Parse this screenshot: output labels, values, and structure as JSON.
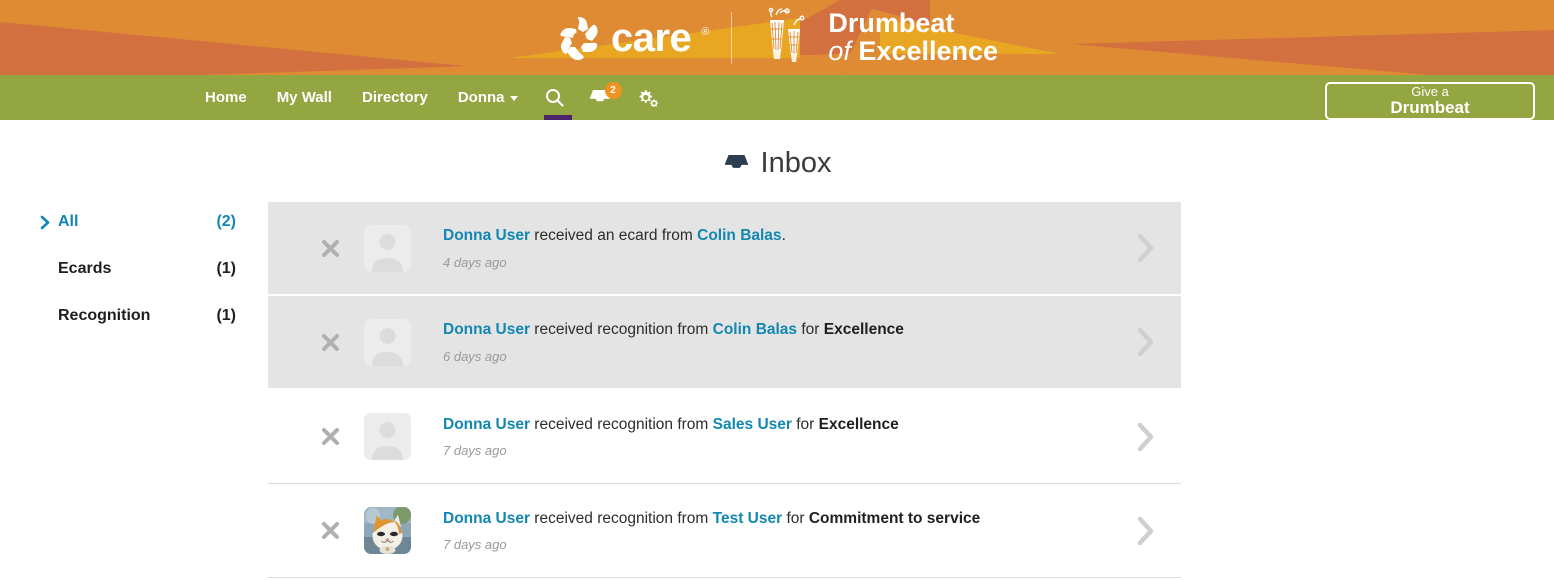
{
  "brand": {
    "logo_name": "care",
    "logo_registered": "®",
    "title_line1": "Drumbeat",
    "title_line2_italic": "of",
    "title_line2_bold": "Excellence",
    "header_bg": "#d2713f",
    "header_accent": "#df8b33",
    "header_highlight": "#e8a622"
  },
  "nav": {
    "bg": "#93a642",
    "items": [
      {
        "label": "Home",
        "has_caret": false
      },
      {
        "label": "My Wall",
        "has_caret": false
      },
      {
        "label": "Directory",
        "has_caret": false
      },
      {
        "label": "Donna",
        "has_caret": true
      }
    ],
    "icons": [
      {
        "name": "search-icon"
      },
      {
        "name": "inbox-icon",
        "badge": "2"
      },
      {
        "name": "settings-gears-icon"
      }
    ],
    "badge_color": "#f0921f",
    "active_indicator_color": "#4b2569",
    "give_button": {
      "line1": "Give a",
      "line2": "Drumbeat"
    }
  },
  "page": {
    "title": "Inbox",
    "title_icon": "inbox-icon"
  },
  "sidebar": {
    "items": [
      {
        "label": "All",
        "count": "(2)",
        "active": true
      },
      {
        "label": "Ecards",
        "count": "(1)",
        "active": false
      },
      {
        "label": "Recognition",
        "count": "(1)",
        "active": false
      }
    ]
  },
  "messages": [
    {
      "recipient": "Donna User",
      "middle": " received an ecard from ",
      "sender": "Colin Balas",
      "suffix": ".",
      "for_label": "",
      "award": "",
      "time": "4 days ago",
      "unread": true,
      "avatar": "placeholder-silhouette"
    },
    {
      "recipient": "Donna User",
      "middle": " received recognition from ",
      "sender": "Colin Balas",
      "suffix": "",
      "for_label": " for ",
      "award": "Excellence",
      "time": "6 days ago",
      "unread": true,
      "avatar": "placeholder-silhouette"
    },
    {
      "recipient": "Donna User",
      "middle": " received recognition from ",
      "sender": "Sales User",
      "suffix": "",
      "for_label": " for ",
      "award": "Excellence",
      "time": "7 days ago",
      "unread": false,
      "avatar": "placeholder-silhouette"
    },
    {
      "recipient": "Donna User",
      "middle": " received recognition from ",
      "sender": "Test User",
      "suffix": "",
      "for_label": " for ",
      "award": "Commitment to service",
      "time": "7 days ago",
      "unread": false,
      "avatar": "cat-photo"
    }
  ],
  "icons": {
    "delete": "close-x-icon",
    "open": "chevron-right-icon"
  },
  "colors": {
    "link_blue": "#1287b1",
    "row_unread_bg": "#e4e4e4",
    "row_read_bg": "#ffffff",
    "muted_text": "#9a9a9a"
  }
}
